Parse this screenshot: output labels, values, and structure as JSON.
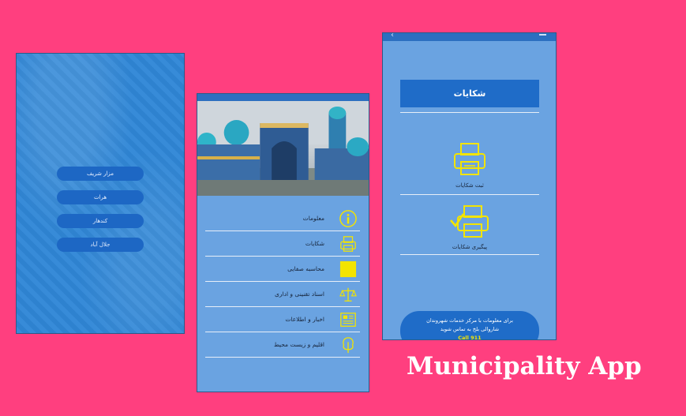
{
  "title": "Municipality App",
  "colors": {
    "background": "#ff3f7f",
    "screen_blue": "#6aa3e1",
    "button_blue": "#1f6cc8",
    "icon_yellow": "#f3e400"
  },
  "city_screen": {
    "cities": [
      "مزار شریف",
      "هرات",
      "کندهار",
      "جلال آباد"
    ]
  },
  "menu_screen": {
    "items": [
      {
        "label": "معلومات",
        "icon": "info-icon"
      },
      {
        "label": "شکایات",
        "icon": "printer-icon"
      },
      {
        "label": "محاسبه صفایی",
        "icon": "calculator-icon"
      },
      {
        "label": "اسناد تقنینی و اداری",
        "icon": "scales-icon"
      },
      {
        "label": "اخبار و اطلاعات",
        "icon": "newspaper-icon"
      },
      {
        "label": "اقلیم و زیست محیط",
        "icon": "tree-icon"
      }
    ]
  },
  "complaints_screen": {
    "header": "شکایات",
    "options": [
      {
        "label": "ثبت شکایات",
        "icon": "printer-icon"
      },
      {
        "label": "پیگیری شکایات",
        "icon": "printer-check-icon"
      }
    ],
    "contact_line1": "برای معلومات با مرکز خدمات شهروندان",
    "contact_line2": "شاروالی بلخ به تماس شوید",
    "contact_phone": "Call 911"
  }
}
